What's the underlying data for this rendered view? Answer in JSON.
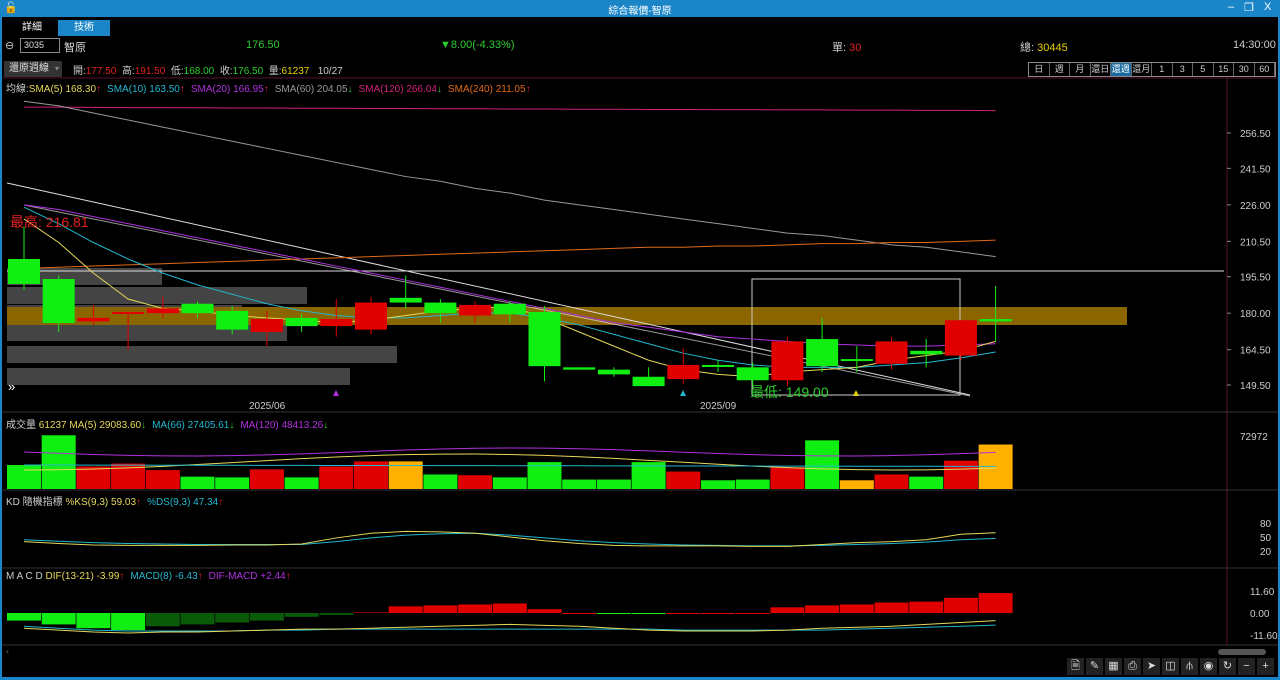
{
  "window": {
    "title": "綜合報價-智原",
    "minimize": "–",
    "restore": "❐",
    "close": "X"
  },
  "tabs": [
    {
      "label": "詳細",
      "active": false
    },
    {
      "label": "技術",
      "active": true
    }
  ],
  "quote": {
    "code": "3035",
    "name": "智原",
    "price": "176.50",
    "change": "▼8.00(-4.33%)",
    "single_label": "單:",
    "single": "30",
    "total_label": "總:",
    "total": "30445",
    "time": "14:30:00"
  },
  "ohlc": {
    "adjust_select": "還原週線",
    "open_label": "開:",
    "open": "177.50",
    "high_label": "高:",
    "high": "191.50",
    "low_label": "低:",
    "low": "168.00",
    "close_label": "收:",
    "close": "176.50",
    "vol_label": "量:",
    "vol": "61237",
    "date": "10/27"
  },
  "intervals": [
    "日",
    "週",
    "月",
    "還日",
    "還週",
    "還月",
    "1",
    "3",
    "5",
    "15",
    "30",
    "60"
  ],
  "active_interval": "還週",
  "ma_legend": {
    "prefix": "均線:",
    "items": [
      {
        "text": "SMA(5) 168.30",
        "arrow": "↑",
        "color": "#e6d85a"
      },
      {
        "text": "SMA(10) 163.50",
        "arrow": "↑",
        "color": "#22b8d0"
      },
      {
        "text": "SMA(20) 166.95",
        "arrow": "↑",
        "color": "#b030e0"
      },
      {
        "text": "SMA(60) 204.05",
        "arrow": "↓",
        "color": "#999999"
      },
      {
        "text": "SMA(120) 266.04",
        "arrow": "↓",
        "color": "#d0207a"
      },
      {
        "text": "SMA(240) 211.05",
        "arrow": "↑",
        "color": "#e06a1a"
      }
    ]
  },
  "annotations": {
    "high": "最高: 216.81",
    "low": "最低: 149.00"
  },
  "x_labels": [
    "2025/06",
    "2025/09"
  ],
  "vol_legend": {
    "title": "成交量",
    "value": "61237",
    "items": [
      {
        "text": "MA(5) 29083.60",
        "arrow": "↓",
        "color": "#e6d85a"
      },
      {
        "text": "MA(66) 27405.61",
        "arrow": "↓",
        "color": "#22b8d0"
      },
      {
        "text": "MA(120) 48413.26",
        "arrow": "↓",
        "color": "#b030e0"
      }
    ]
  },
  "kd_legend": {
    "title": "KD 隨機指標",
    "items": [
      {
        "text": "%KS(9,3) 59.03",
        "arrow": "↑",
        "color": "#e6d85a"
      },
      {
        "text": "%DS(9,3) 47.34",
        "arrow": "↑",
        "color": "#22b8d0"
      }
    ]
  },
  "macd_legend": {
    "title": "M A C D",
    "items": [
      {
        "text": "DIF(13-21)  -3.99",
        "arrow": "↑",
        "color": "#e6d85a"
      },
      {
        "text": "MACD(8)  -6.43",
        "arrow": "↑",
        "color": "#22b8d0"
      },
      {
        "text": "DIF-MACD  +2.44",
        "arrow": "↑",
        "color": "#b030e0"
      }
    ]
  },
  "toolbar": [
    "doc",
    "draw",
    "table-search",
    "print",
    "pointer",
    "panel",
    "indicator",
    "eye",
    "refresh",
    "zoom-out",
    "zoom-in"
  ],
  "chart_data": {
    "type": "candlestick",
    "price_ticks": [
      "256.50",
      "241.50",
      "226.00",
      "210.50",
      "195.50",
      "180.00",
      "164.50",
      "149.50"
    ],
    "vol_ticks": [
      "72972"
    ],
    "kd_ticks": [
      "80",
      "50",
      "20"
    ],
    "macd_ticks": [
      "11.60",
      "0.00",
      "-11.60"
    ],
    "ohlc": [
      [
        203,
        216.8,
        190,
        192.4
      ],
      [
        194.5,
        196,
        172,
        175.8
      ],
      [
        176.5,
        183.5,
        175,
        178
      ],
      [
        180,
        180.5,
        164.4,
        180.5
      ],
      [
        180,
        187,
        178,
        182
      ],
      [
        184,
        185,
        178,
        180
      ],
      [
        181,
        183,
        171,
        173
      ],
      [
        172,
        181,
        166,
        177.5
      ],
      [
        178,
        180,
        172,
        174.5
      ],
      [
        174.5,
        186,
        170,
        177.5
      ],
      [
        173,
        187,
        171,
        184.5
      ],
      [
        186.5,
        196,
        182,
        184.5
      ],
      [
        184.5,
        186,
        176,
        180
      ],
      [
        179,
        185,
        176,
        183.5
      ],
      [
        184,
        185,
        176,
        179.5
      ],
      [
        180.5,
        183,
        151,
        157.5
      ],
      [
        157,
        157,
        156,
        156
      ],
      [
        156,
        157,
        153,
        154
      ],
      [
        153,
        157,
        149,
        149
      ],
      [
        152,
        165,
        150,
        158
      ],
      [
        158,
        160,
        155,
        157.5
      ],
      [
        157,
        159,
        149,
        151.5
      ],
      [
        151.5,
        170,
        149,
        168
      ],
      [
        169,
        178,
        155,
        157.5
      ],
      [
        160.5,
        166,
        155,
        160
      ],
      [
        158.5,
        170,
        156,
        168
      ],
      [
        164,
        169,
        157,
        162.5
      ],
      [
        162,
        177,
        160,
        177
      ],
      [
        177.5,
        191.5,
        168,
        176.5
      ]
    ],
    "sma5": [
      220,
      210,
      197,
      186,
      182,
      181,
      179,
      178,
      177,
      176,
      177,
      179,
      181,
      182,
      183,
      178,
      172,
      166,
      160,
      156,
      154,
      153,
      155,
      156,
      157,
      160,
      162,
      164,
      168
    ],
    "sma10": [
      225,
      218,
      210,
      203,
      197,
      192,
      188,
      184,
      181,
      179,
      178,
      178,
      179,
      180,
      180,
      178,
      175,
      171,
      167,
      163,
      160,
      158,
      157,
      157,
      157,
      158,
      159,
      161,
      163.5
    ],
    "sma20": [
      226,
      224,
      221,
      218,
      215,
      212,
      209,
      206,
      203,
      200,
      197,
      194,
      191,
      188,
      185,
      182,
      179,
      176,
      174,
      172,
      170,
      169,
      168,
      167,
      166.5,
      166,
      166,
      166.5,
      167
    ],
    "sma60": [
      270,
      268,
      265,
      262,
      259,
      256,
      253,
      250,
      247,
      244,
      241,
      238,
      236,
      233,
      231,
      228,
      226,
      224,
      222,
      220,
      218,
      216,
      214,
      213,
      211,
      209,
      208,
      206,
      204
    ],
    "sma120": [
      267.5,
      267.5,
      267.4,
      267.3,
      267.3,
      267.2,
      267.1,
      267.1,
      267,
      267,
      266.9,
      266.9,
      266.8,
      266.8,
      266.7,
      266.7,
      266.6,
      266.6,
      266.5,
      266.5,
      266.4,
      266.4,
      266.3,
      266.3,
      266.2,
      266.2,
      266.1,
      266.1,
      266
    ],
    "sma240": [
      199,
      199.5,
      200,
      200.5,
      201,
      201.5,
      202,
      202.5,
      203,
      203.5,
      204,
      204.5,
      205,
      205.5,
      206,
      206.5,
      207,
      207.5,
      208,
      208,
      208.5,
      208.5,
      209,
      209.5,
      209.5,
      210,
      210,
      210.5,
      211
    ],
    "volume": [
      33000,
      74000,
      31000,
      35000,
      26000,
      17000,
      16000,
      27000,
      16000,
      31000,
      38000,
      38000,
      20000,
      19000,
      16000,
      37000,
      13000,
      13000,
      37000,
      24000,
      12000,
      13000,
      30000,
      67000,
      12000,
      20000,
      17000,
      39000,
      61237
    ],
    "vol_up": [
      "g",
      "g",
      "r",
      "r",
      "r",
      "g",
      "g",
      "r",
      "g",
      "r",
      "r",
      "o",
      "g",
      "r",
      "g",
      "g",
      "g",
      "g",
      "g",
      "r",
      "g",
      "g",
      "r",
      "g",
      "o",
      "r",
      "g",
      "r",
      "o"
    ],
    "k": [
      40,
      36,
      33,
      32,
      32,
      32,
      33,
      33,
      35,
      48,
      58,
      62,
      61,
      58,
      50,
      42,
      36,
      32,
      31,
      31,
      31,
      30,
      30,
      34,
      38,
      40,
      44,
      56,
      59
    ],
    "d": [
      44,
      41,
      38,
      36,
      35,
      34,
      34,
      34,
      34,
      40,
      48,
      54,
      57,
      58,
      54,
      48,
      42,
      38,
      35,
      33,
      32,
      31,
      31,
      32,
      34,
      36,
      39,
      44,
      47
    ],
    "macd_hist": [
      -4,
      -6,
      -8,
      -9,
      -7,
      -6,
      -5,
      -4,
      -2,
      -1,
      0.5,
      3.5,
      4,
      4.5,
      5,
      2,
      0,
      -0.5,
      -0.5,
      0,
      0,
      0,
      3,
      4,
      4.5,
      5.5,
      6,
      8,
      10.5
    ],
    "dif": [
      -8,
      -9,
      -10,
      -10.5,
      -10,
      -10,
      -9.5,
      -9,
      -8.5,
      -8.5,
      -8,
      -7.5,
      -7,
      -6.5,
      -6,
      -6.5,
      -7,
      -8,
      -9,
      -9.5,
      -9.5,
      -9.5,
      -9,
      -8,
      -7.5,
      -7,
      -6,
      -5,
      -4
    ],
    "macd": [
      -7,
      -8,
      -9,
      -9.5,
      -9.5,
      -9.5,
      -9.5,
      -9,
      -9,
      -8.5,
      -8.5,
      -8.5,
      -8.5,
      -8.5,
      -8.5,
      -8.5,
      -8.5,
      -8.5,
      -8.5,
      -9,
      -9,
      -9,
      -9,
      -9,
      -8.5,
      -8,
      -7.5,
      -7,
      -6.4
    ]
  }
}
